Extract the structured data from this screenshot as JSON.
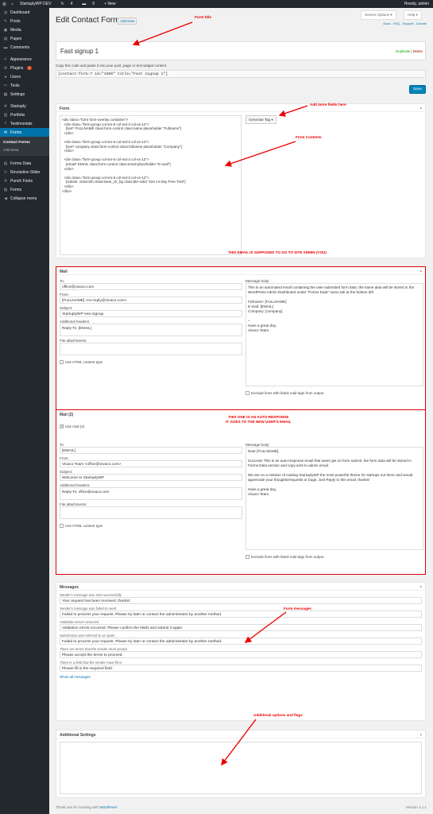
{
  "adminbar": {
    "site": "StartuplyWP DEV",
    "updates": "4",
    "comments": "0",
    "new": "+ New",
    "howdy": "Howdy, admin"
  },
  "sidebar": {
    "items": [
      {
        "icon": "dashboard-icon",
        "label": "Dashboard",
        "glyph": "◍"
      },
      {
        "icon": "pin-icon",
        "label": "Posts",
        "glyph": "✎"
      },
      {
        "icon": "media-icon",
        "label": "Media",
        "glyph": "▣"
      },
      {
        "icon": "page-icon",
        "label": "Pages",
        "glyph": "▤"
      },
      {
        "icon": "comment-icon",
        "label": "Comments",
        "glyph": "▬"
      }
    ],
    "items2": [
      {
        "icon": "appearance-icon",
        "label": "Appearance",
        "glyph": "✐"
      },
      {
        "icon": "plugin-icon",
        "label": "Plugins",
        "glyph": "⚙",
        "badge": "1"
      },
      {
        "icon": "users-icon",
        "label": "Users",
        "glyph": "●"
      },
      {
        "icon": "tools-icon",
        "label": "Tools",
        "glyph": "✂"
      },
      {
        "icon": "settings-icon",
        "label": "Settings",
        "glyph": "▦"
      }
    ],
    "items3": [
      {
        "icon": "startuply-icon",
        "label": "Startuply",
        "glyph": "✲"
      },
      {
        "icon": "portfolio-icon",
        "label": "Portfolio",
        "glyph": "▥"
      },
      {
        "icon": "quote-icon",
        "label": "Testimonials",
        "glyph": "❝"
      }
    ],
    "forms_label": "Forms",
    "submenu": [
      "Contact Forms",
      "Add New"
    ],
    "items4": [
      {
        "icon": "forms-data-icon",
        "label": "Forms Data",
        "glyph": "▤"
      },
      {
        "icon": "revolution-icon",
        "label": "Revolution Slider",
        "glyph": "↻"
      },
      {
        "icon": "font-icon",
        "label": "Punch Fonts",
        "glyph": "A"
      },
      {
        "icon": "forms-icon",
        "label": "Forms",
        "glyph": "▤"
      },
      {
        "icon": "collapse-icon",
        "label": "Collapse menu",
        "glyph": "◀"
      }
    ]
  },
  "header": {
    "title": "Edit Contact Form",
    "add_new": "Add New",
    "screen_options": "Screen Options ▾",
    "help": "Help ▾",
    "links": "Docs - FAQ - Support - Donate"
  },
  "titlebox": {
    "name": "Fast signup 1",
    "duplicate": "Duplicate",
    "delete": "Delete",
    "copy_text": "Copy this code and paste it into your post, page or text widget content.",
    "shortcode": "[contact-form-7 id=\"1500\" title=\"Fast signup 1\"]",
    "save": "Save"
  },
  "form_box": {
    "heading": "Form",
    "generate_tag": "Generate Tag ▾",
    "content": "<div class=\"form form-overlay container\">\n  <div class=\"form-group col-sm-6 col-md-3 col-xs-12\">\n    [text* FULLNAME class:form-control class:name placeholder \"Fullname\"]\n  </div>\n\n  <div class=\"form-group col-sm-6 col-md-3 col-xs-12\">\n    [text* company class:form-control class:fullname placeholder \"Company\"]\n  </div>\n\n  <div class=\"form-group col-sm-6 col-md-3 col-xs-12\">\n    [email* EMAIL class:form-control class:email placeholder \"E-mail\"]\n  </div>\n\n  <div class=\"form-group col-sm-6 col-md-3 col-xs-12\">\n    [submit  class:btn class:base_clr_bg class:btn-solid \"Get 14 Day Free Trial\"]\n  </div>\n</div>"
  },
  "mail1": {
    "heading": "Mail",
    "to_label": "To:",
    "to": "office@vivaco.com",
    "from_label": "From:",
    "from": "[FULLNAME] <no-reply@vivaco.com>",
    "subject_label": "Subject:",
    "subject": "StartuplyWP new signup",
    "headers_label": "Additional headers:",
    "headers": "Reply-To: [EMAIL]",
    "attach_label": "File attachments:",
    "html_label": "Use HTML content type",
    "body_label": "Message body:",
    "body": "This is an automated email containing the user submitted form data. the same data will be stored in the WordPress Admin Dashboard under \"Forms Data\" menu tab at the bottom left\n\nFullname: [FULLNAME]\nE-mail: [EMAIL]\nCompany: [company]\n\n--\nHave a great day,\nVivaco Team.",
    "exclude_label": "Exclude lines with blank mail-tags from output"
  },
  "mail2": {
    "heading": "Mail (2)",
    "use_label": "Use mail (2)",
    "to_label": "To:",
    "to": "[EMAIL]",
    "from_label": "From:",
    "from": "Vivaco Team <office@vivaco.com>",
    "subject_label": "Subject:",
    "subject": "Welcome to StartuplyWP",
    "headers_label": "Additional headers:",
    "headers": "Reply-To: office@vivaco.com",
    "attach_label": "File attachments:",
    "html_label": "Use HTML content type",
    "body_label": "Message body:",
    "body": "Dear [FULLNAME],\n\nSuccess! This is an auto-response email that users get on form submit. the form data will be stored in Forms Data section and copy sent to admin email.\n\nWe are on a mission of making StartuplyWP the most powerful theme for startups out there and would appreciate your thoughts/requests or bugs. Just Reply to this email, thanks!\n\nHave a great day,\nVivaco Team.",
    "exclude_label": "Exclude lines with blank mail-tags from output"
  },
  "messages": {
    "heading": "Messages",
    "rows": [
      {
        "label": "Sender's message was sent successfully",
        "value": "Your request has been received, thanks!"
      },
      {
        "label": "Sender's message was failed to send",
        "value": "Failed to process your request. Please try later or contact the administrator by another method."
      },
      {
        "label": "Validation errors occurred",
        "value": "Validation errors occurred. Please confirm the fields and submit it again."
      },
      {
        "label": "Submission was referred to as spam",
        "value": "Failed to process your request. Please try later or contact the administrator by another method."
      },
      {
        "label": "There are terms that the sender must accept",
        "value": "Please accept the terms to proceed."
      },
      {
        "label": "There is a field that the sender must fill in",
        "value": "Please fill in the required field."
      }
    ],
    "show_all": "Show all messages"
  },
  "additional": {
    "heading": "Additional Settings"
  },
  "footer": {
    "left": "Thank you for creating with",
    "wp": "WordPress",
    "version": "Version 4.1.1"
  },
  "annotations": {
    "form_title": "Form title",
    "add_fields": "Add more fields here",
    "form_contents": "Form Contents",
    "email_admin": "THIS EMAIL IS SUPPOSED TO GO TO SITE ADMIN (YOU)",
    "auto_response": "THIS ONE IS AN AUTO-RESPONSE\nIT GOES TO THE NEW USER'S EMAIL",
    "form_messages": "Form messages",
    "additional_opts": "Additional options and flags"
  },
  "colors": {
    "annotation": "#e00000",
    "accent": "#0073aa",
    "sidebar": "#23282d"
  }
}
